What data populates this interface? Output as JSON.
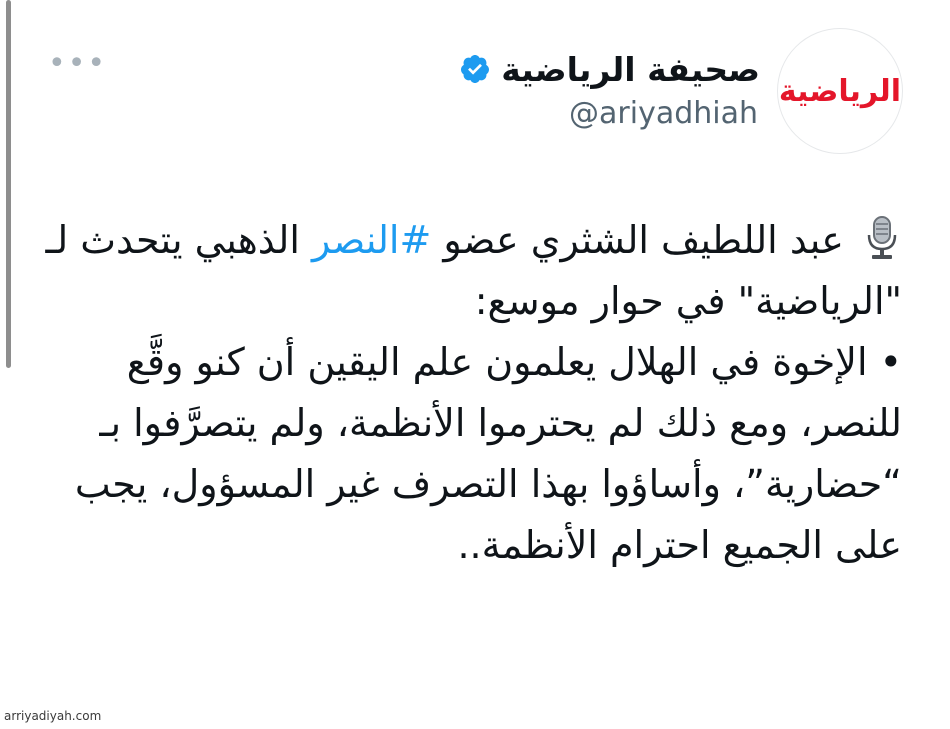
{
  "account": {
    "display_name": "صحيفة الرياضية",
    "handle": "@ariyadhiah",
    "verified": true,
    "avatar_logo_text": "الرياضية",
    "brand_color": "#e4162a"
  },
  "more_menu": "more-dots-icon",
  "tweet": {
    "mic_icon": "studio-microphone-icon",
    "part1": " عبد اللطيف الشثري عضو ",
    "hashtag": "#النصر",
    "part2": " الذهبي يتحدث لـ \"الرياضية\" في حوار موسع:",
    "bullet": "• الإخوة في الهلال يعلمون علم اليقين أن كنو وقَّع للنصر، ومع ذلك لم يحترموا الأنظمة، ولم يتصرَّفوا بـ “حضارية”، وأساؤوا بهذا التصرف غير المسؤول، يجب على الجميع احترام الأنظمة..",
    "hashtag_color": "#1d9bf0"
  },
  "watermark": "arriyadiyah.com"
}
